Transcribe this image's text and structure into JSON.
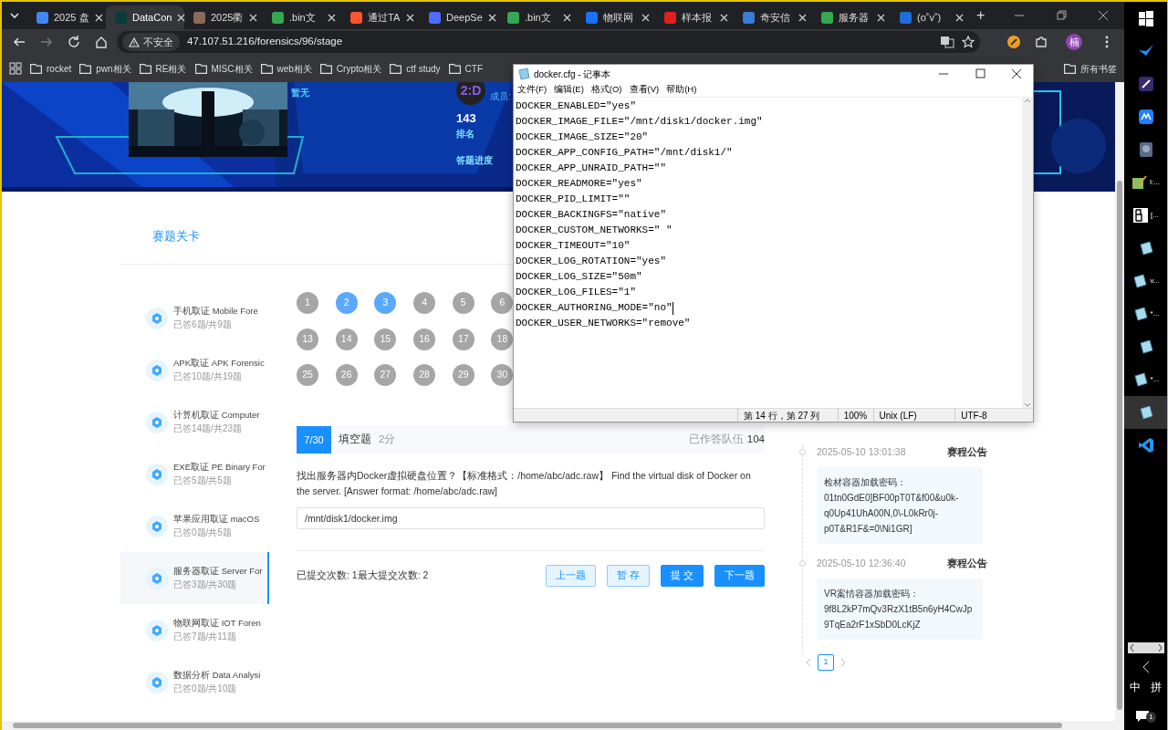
{
  "browser": {
    "tabs": [
      {
        "title": "2025 盘",
        "color": "#4285f4",
        "selected": false
      },
      {
        "title": "DataCon",
        "color": "#0b3b3b",
        "selected": true
      },
      {
        "title": "2025衢",
        "color": "#8a6a5a",
        "selected": false
      },
      {
        "title": ".bin文",
        "color": "#34a853",
        "selected": false
      },
      {
        "title": "通过TA",
        "color": "#fc5531",
        "selected": false
      },
      {
        "title": "DeepSe",
        "color": "#4d6bfe",
        "selected": false
      },
      {
        "title": ".bin文",
        "color": "#34a853",
        "selected": false
      },
      {
        "title": "物联网",
        "color": "#1772f6",
        "selected": false
      },
      {
        "title": "样本报",
        "color": "#e02020",
        "selected": false
      },
      {
        "title": "奇安信",
        "color": "#3a7bd5",
        "selected": false
      },
      {
        "title": "服务器",
        "color": "#34a853",
        "selected": false
      },
      {
        "title": "(o˚v˚)",
        "color": "#1e6fd9",
        "selected": false
      }
    ],
    "new_tab": "+",
    "address": {
      "security": "不安全",
      "url": "47.107.51.216/forensics/96/stage"
    },
    "profile": "楠",
    "bookmarks": [
      "rocket",
      "pwn相关",
      "RE相关",
      "MISC相关",
      "web相关",
      "Crypto相关",
      "ctf study",
      "CTF"
    ],
    "all_bookmarks": "所有书签"
  },
  "banner": {
    "status": "暂无",
    "avatar": "2:D",
    "members_label": "成员:",
    "rank": "143",
    "rank_label": "排名",
    "progress_label": "答题进度"
  },
  "section_title": "赛题关卡",
  "categories": [
    {
      "title": "手机取证 Mobile Fore",
      "progress": "已答6题/共9题",
      "selected": false
    },
    {
      "title": "APK取证 APK Forensic",
      "progress": "已答10题/共19题",
      "selected": false
    },
    {
      "title": "计算机取证 Computer",
      "progress": "已答14题/共23题",
      "selected": false
    },
    {
      "title": "EXE取证 PE Binary For",
      "progress": "已答5题/共5题",
      "selected": false
    },
    {
      "title": "苹果应用取证 macOS",
      "progress": "已答0题/共5题",
      "selected": false
    },
    {
      "title": "服务器取证 Server For",
      "progress": "已答3题/共30题",
      "selected": true
    },
    {
      "title": "物联网取证 IOT Foren",
      "progress": "已答7题/共11题",
      "selected": false
    },
    {
      "title": "数据分析 Data Analysi",
      "progress": "已答0题/共10题",
      "selected": false
    }
  ],
  "questions": [
    {
      "number": "1",
      "answered": false
    },
    {
      "number": "2",
      "answered": true
    },
    {
      "number": "3",
      "answered": true
    },
    {
      "number": "4",
      "answered": false
    },
    {
      "number": "5",
      "answered": false
    },
    {
      "number": "6",
      "answered": false
    },
    {
      "number": "13",
      "answered": false
    },
    {
      "number": "14",
      "answered": false
    },
    {
      "number": "15",
      "answered": false
    },
    {
      "number": "16",
      "answered": false
    },
    {
      "number": "17",
      "answered": false
    },
    {
      "number": "18",
      "answered": false
    },
    {
      "number": "25",
      "answered": false
    },
    {
      "number": "26",
      "answered": false
    },
    {
      "number": "27",
      "answered": false
    },
    {
      "number": "28",
      "answered": false
    },
    {
      "number": "29",
      "answered": false
    },
    {
      "number": "30",
      "answered": false
    }
  ],
  "question": {
    "index": "7/30",
    "type": "填空题",
    "points": "2分",
    "answered_label": "已作答队伍",
    "answered_count": "104",
    "text": "找出服务器内Docker虚拟硬盘位置？【标准格式：/home/abc/adc.raw】 Find the virtual disk of Docker on the server. [Answer format: /home/abc/adc.raw]",
    "answer": "/mnt/disk1/docker.img",
    "submissions": "已提交次数: 1最大提交次数: 2",
    "buttons": [
      {
        "label": "上一题",
        "kind": "outline"
      },
      {
        "label": "暂 存",
        "kind": "outline"
      },
      {
        "label": "提 交",
        "kind": "primary"
      },
      {
        "label": "下一题",
        "kind": "primary"
      }
    ]
  },
  "announcements": [
    {
      "time": "2025-05-10 13:01:38",
      "title": "赛程公告",
      "lines": [
        "检材容器加载密码：",
        "01tn0GdE0]BF00pT0T&f00&u0k-q0Up41UhA00N,0\\-L0kRr0j-p0T&R1F&=0\\Ni1GR]"
      ]
    },
    {
      "time": "2025-05-10 12:36:40",
      "title": "赛程公告",
      "lines": [
        "VR案情容器加载密码：",
        "9f8L2kP7mQv3RzX1tB5n6yH4CwJp9TqEa2rF1xSbD0LcKjZ"
      ]
    }
  ],
  "pagination": {
    "pages": [
      {
        "label": "1",
        "selected": true
      }
    ]
  },
  "notepad": {
    "title": "docker.cfg - 记事本",
    "menu": [
      "文件(F)",
      "编辑(E)",
      "格式(O)",
      "查看(V)",
      "帮助(H)"
    ],
    "lines": [
      {
        "text": "DOCKER_ENABLED=\"yes\"",
        "caret": false
      },
      {
        "text": "DOCKER_IMAGE_FILE=\"/mnt/disk1/docker.img\"",
        "caret": false
      },
      {
        "text": "DOCKER_IMAGE_SIZE=\"20\"",
        "caret": false
      },
      {
        "text": "DOCKER_APP_CONFIG_PATH=\"/mnt/disk1/\"",
        "caret": false
      },
      {
        "text": "DOCKER_APP_UNRAID_PATH=\"\"",
        "caret": false
      },
      {
        "text": "DOCKER_READMORE=\"yes\"",
        "caret": false
      },
      {
        "text": "DOCKER_PID_LIMIT=\"\"",
        "caret": false
      },
      {
        "text": "DOCKER_BACKINGFS=\"native\"",
        "caret": false
      },
      {
        "text": "DOCKER_CUSTOM_NETWORKS=\" \"",
        "caret": false
      },
      {
        "text": "DOCKER_TIMEOUT=\"10\"",
        "caret": false
      },
      {
        "text": "DOCKER_LOG_ROTATION=\"yes\"",
        "caret": false
      },
      {
        "text": "DOCKER_LOG_SIZE=\"50m\"",
        "caret": false
      },
      {
        "text": "DOCKER_LOG_FILES=\"1\"",
        "caret": false
      },
      {
        "text": "DOCKER_AUTHORING_MODE=\"no\"",
        "caret": true
      },
      {
        "text": "DOCKER_USER_NETWORKS=\"remove\"",
        "caret": false
      }
    ],
    "status": {
      "position": "第 14 行，第 27 列",
      "zoom": "100%",
      "line_ending": "Unix (LF)",
      "encoding": "UTF-8"
    }
  },
  "taskbar": {
    "items": [
      {
        "kind": "windows",
        "selected": false
      },
      {
        "kind": "feather",
        "selected": false
      },
      {
        "kind": "pen",
        "selected": false
      },
      {
        "kind": "m",
        "selected": false
      },
      {
        "kind": "disk",
        "selected": false
      },
      {
        "kind": "editor",
        "label": "I:...",
        "selected": false
      },
      {
        "kind": "bc",
        "label": "[...",
        "selected": false
      },
      {
        "kind": "notepad",
        "selected": false
      },
      {
        "kind": "notepad",
        "label": "v...",
        "selected": false
      },
      {
        "kind": "notepad",
        "label": "*...",
        "selected": false
      },
      {
        "kind": "notepad",
        "selected": false
      },
      {
        "kind": "notepad",
        "label": "*...",
        "selected": false
      },
      {
        "kind": "notepad",
        "selected": true
      },
      {
        "kind": "vscode",
        "selected": false
      }
    ],
    "ime": [
      "中",
      "拼"
    ],
    "notifications": "1"
  }
}
